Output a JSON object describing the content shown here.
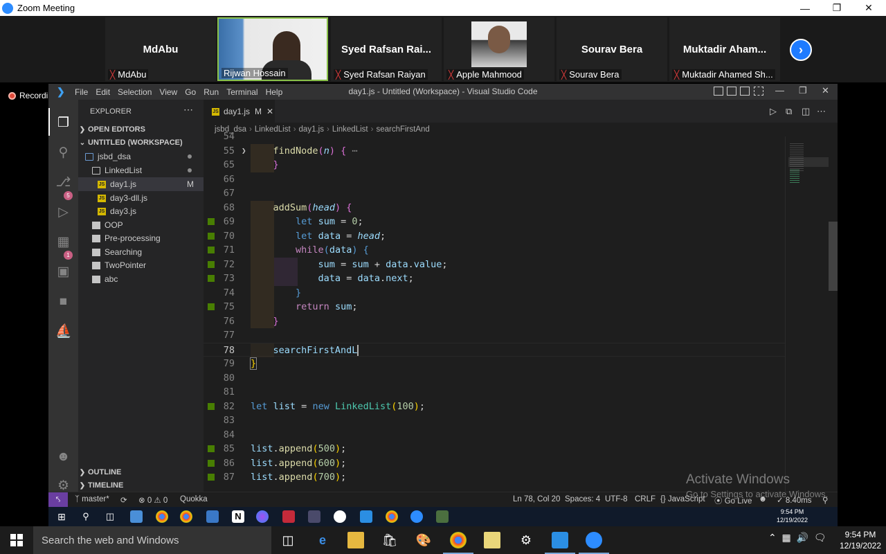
{
  "zoom": {
    "window_title": "Zoom Meeting",
    "recording_label": "Recording",
    "participants": [
      {
        "big_name": "MdAbu",
        "label": "MdAbu",
        "muted": true
      },
      {
        "big_name": "",
        "label": "Rijwan Hossain",
        "muted": false
      },
      {
        "big_name": "Syed Rafsan Rai...",
        "label": "Syed Rafsan Raiyan",
        "muted": true
      },
      {
        "big_name": "",
        "label": "Apple Mahmood",
        "muted": true
      },
      {
        "big_name": "Sourav Bera",
        "label": "Sourav Bera",
        "muted": true
      },
      {
        "big_name": "Muktadir Aham...",
        "label": "Muktadir Ahamed Sh...",
        "muted": true
      }
    ]
  },
  "vscode": {
    "menu": [
      "File",
      "Edit",
      "Selection",
      "View",
      "Go",
      "Run",
      "Terminal",
      "Help"
    ],
    "window_title": "day1.js - Untitled (Workspace) - Visual Studio Code",
    "explorer_header": "EXPLORER",
    "sections": {
      "open_editors": "OPEN EDITORS",
      "workspace": "UNTITLED (WORKSPACE)",
      "outline": "OUTLINE",
      "timeline": "TIMELINE"
    },
    "tree": [
      {
        "label": "jsbd_dsa",
        "type": "root"
      },
      {
        "label": "LinkedList",
        "type": "folder-open"
      },
      {
        "label": "day1.js",
        "type": "js",
        "status": "M"
      },
      {
        "label": "day3-dll.js",
        "type": "js"
      },
      {
        "label": "day3.js",
        "type": "js"
      },
      {
        "label": "OOP",
        "type": "folder"
      },
      {
        "label": "Pre-processing",
        "type": "folder"
      },
      {
        "label": "Searching",
        "type": "folder"
      },
      {
        "label": "TwoPointer",
        "type": "folder"
      },
      {
        "label": "abc",
        "type": "folder"
      }
    ],
    "activity_badges": {
      "scm": "5",
      "extensions": "1"
    },
    "tab": {
      "label": "day1.js",
      "status": "M",
      "close": "✕"
    },
    "breadcrumb": [
      "jsbd_dsa",
      "LinkedList",
      "day1.js",
      "LinkedList",
      "searchFirstAnd"
    ],
    "statusbar": {
      "branch": "master*",
      "errors": "⊗ 0 ⚠ 0",
      "quokka": "Quokka",
      "position": "Ln 78, Col 20",
      "spaces": "Spaces: 4",
      "encoding": "UTF-8",
      "eol": "CRLF",
      "language": "{} JavaScript",
      "golive": "Go Live",
      "timing": "8.40ms"
    }
  },
  "watermark": {
    "title": "Activate Windows",
    "subtitle": "Go to Settings to activate Windows."
  },
  "inner_clock": {
    "time": "9:54 PM",
    "date": "12/19/2022"
  },
  "taskbar": {
    "search_placeholder": "Search the web and Windows",
    "time": "9:54 PM",
    "date": "12/19/2022"
  }
}
